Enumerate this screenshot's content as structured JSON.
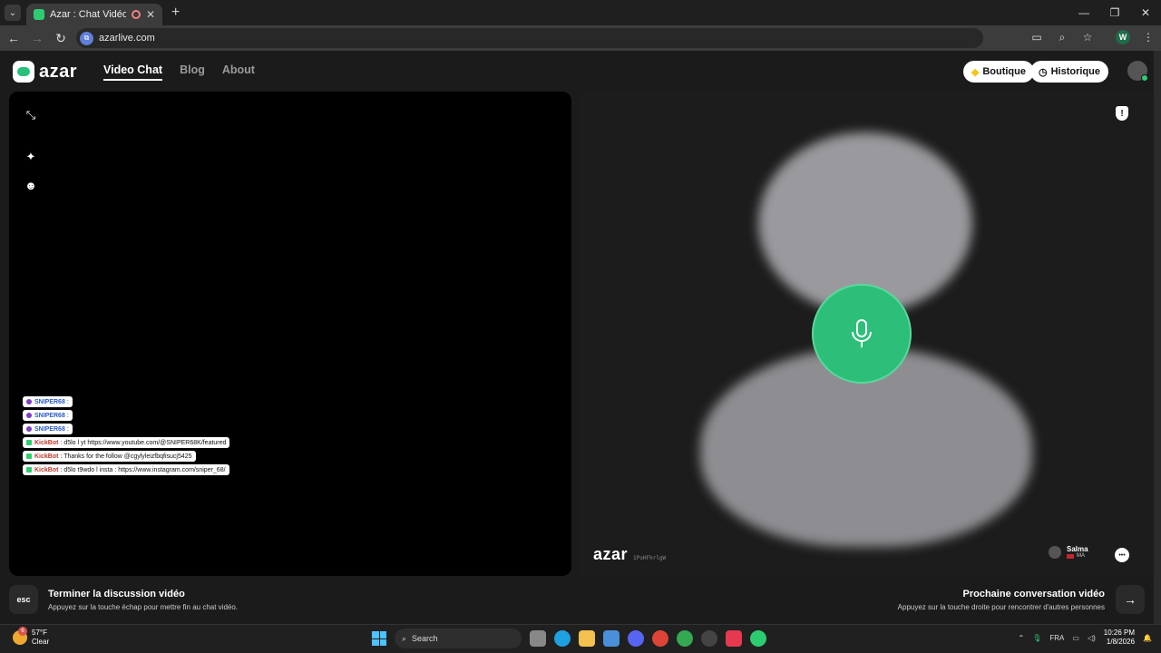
{
  "browser": {
    "tab_title": "Azar : Chat Vidéo avec de n",
    "url": "azarlive.com",
    "profile_initial": "W"
  },
  "header": {
    "logo": "azar",
    "nav": [
      "Video Chat",
      "Blog",
      "About"
    ],
    "boutique_label": "Boutique",
    "historique_label": "Historique"
  },
  "chat_overlay": [
    {
      "name": "SNIPER68",
      "text": ":"
    },
    {
      "name": "SNIPER68",
      "text": ":"
    },
    {
      "name": "SNIPER68",
      "text": ":"
    },
    {
      "name": "KickBot",
      "text": ": d5lo l yt https://www.youtube.com/@SNIPER68K/featured"
    },
    {
      "name": "KickBot",
      "text": ": Thanks for the follow @cgylyleizfbqfisucj5425"
    },
    {
      "name": "KickBot",
      "text": ": d5lo t9wdo l insta : https://www.instagram.com/sniper_68/"
    }
  ],
  "remote": {
    "watermark": "azar",
    "id": "1PoHFhrlgW",
    "peer_name": "Salma",
    "peer_country": "MA"
  },
  "footer": {
    "esc_key": "esc",
    "end_title": "Terminer la discussion vidéo",
    "end_sub": "Appuyez sur la touche échap pour mettre fin au chat vidéo.",
    "next_title": "Prochaine conversation vidéo",
    "next_sub": "Appuyez sur la touche droite pour rencontrer d'autres personnes"
  },
  "taskbar": {
    "weather_badge": "6",
    "temperature": "57°F",
    "condition": "Clear",
    "search_label": "Search",
    "lang": "FRA",
    "time": "10:26 PM",
    "date": "1/8/2026"
  },
  "colors": {
    "accent": "#2dbf7a",
    "brand_green": "#27c17b",
    "background": "#1b1b1b"
  }
}
